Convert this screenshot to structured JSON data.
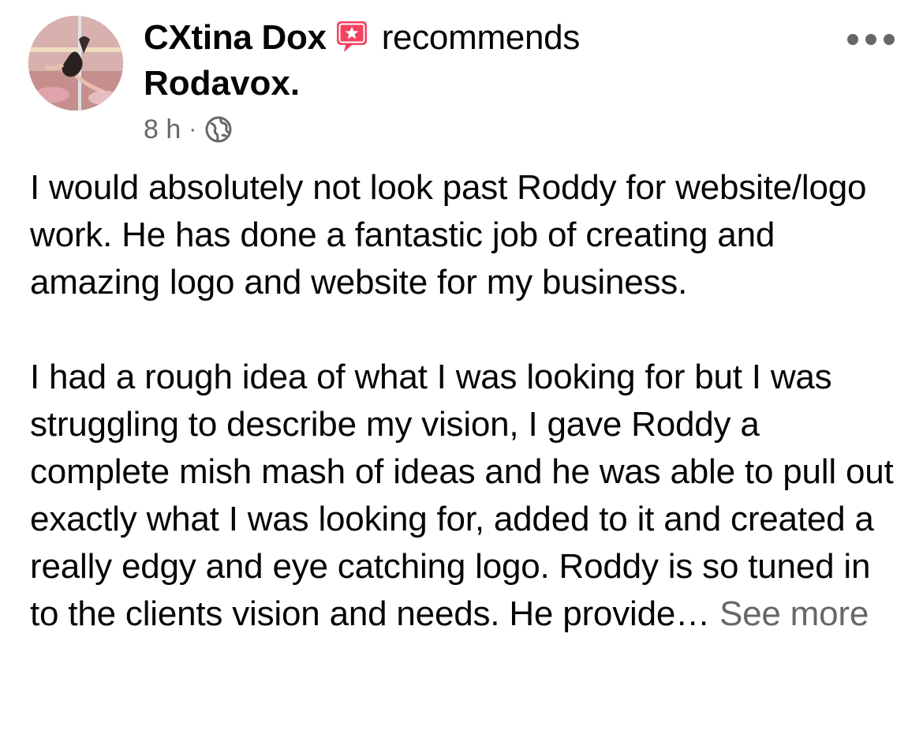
{
  "post": {
    "author": "CXtina Dox",
    "action": "recommends",
    "page": "Rodavox.",
    "timestamp": "8 h",
    "separator": "·",
    "privacy_icon": "globe-icon",
    "badge_icon": "recommendation-star-icon",
    "more_icon": "more-options-icon",
    "paragraphs": [
      "I would absolutely not look past Roddy for website/logo work. He has done a fantastic job of creating and amazing logo and website for my business.",
      "I had a rough idea of what I was looking for but I was struggling to describe my vision, I gave Roddy a complete mish mash of ideas and he was able to pull out exactly what I was looking for, added to it and created a really edgy and eye catching logo. Roddy is so tuned in to the clients vision and needs. He provide…"
    ],
    "see_more": "See more"
  },
  "colors": {
    "text_primary": "#050505",
    "text_secondary": "#65676b",
    "badge_pink": "#f3425f",
    "background": "#ffffff"
  }
}
